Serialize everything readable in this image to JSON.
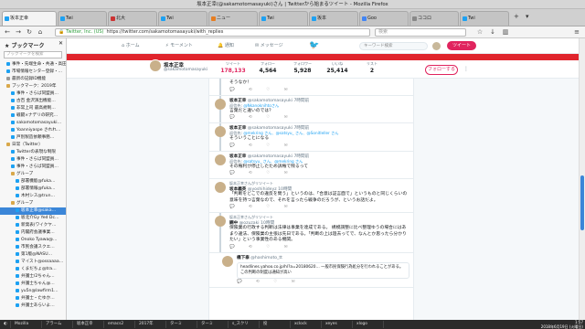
{
  "window": {
    "title": "坂本正幸(@sakamotomasayuki)さん | Twitterから始まるツイート - Mozilla Firefox"
  },
  "tabs": [
    {
      "label": "坂本正幸"
    },
    {
      "label": "Twi"
    },
    {
      "label": "北大"
    },
    {
      "label": "Twi"
    },
    {
      "label": "ニュー"
    },
    {
      "label": "Twi"
    },
    {
      "label": "坂本"
    },
    {
      "label": "Goo"
    },
    {
      "label": "ココロ"
    },
    {
      "label": "Twi"
    }
  ],
  "navbar": {
    "back": "←",
    "forward": "→",
    "reload": "↻",
    "home": "⌂",
    "lock": "🔒",
    "org": "Twitter, Inc. (US)",
    "url": "https://twitter.com/sakamotomasayuki/with_replies",
    "search_placeholder": "検索"
  },
  "sidebar": {
    "title": "ブックマーク",
    "close": "✕",
    "search_placeholder": "ブックマークを検索",
    "items": [
      {
        "label": "事件・先端生命・共通・高田…",
        "icon": "blue",
        "indent": 1,
        "selected": false
      },
      {
        "label": "市場情報センター登録・…",
        "icon": "blue",
        "indent": 1,
        "selected": false
      },
      {
        "label": "最新の記録ID機能",
        "icon": "gray",
        "indent": 1,
        "selected": false
      },
      {
        "label": "ブックマーク：2019年",
        "icon": "folder",
        "indent": 1,
        "selected": false
      },
      {
        "label": "事件・さらば同盟員…",
        "icon": "blue",
        "indent": 2,
        "selected": false
      },
      {
        "label": "古百 金沢演出機能…",
        "icon": "blue",
        "indent": 2,
        "selected": false
      },
      {
        "label": "非常上司 最高規制…",
        "icon": "blue",
        "indent": 2,
        "selected": false
      },
      {
        "label": "戦闘×ナデリの研究…",
        "icon": "blue",
        "indent": 2,
        "selected": false
      },
      {
        "label": "sakamotomasayuki…",
        "icon": "blue",
        "indent": 2,
        "selected": false
      },
      {
        "label": "Yoanniyaspe されれ…",
        "icon": "blue",
        "indent": 2,
        "selected": false
      },
      {
        "label": "戸別製造依頼事務…",
        "icon": "blue",
        "indent": 2,
        "selected": false
      },
      {
        "label": "日常（Twitter）",
        "icon": "folder",
        "indent": 1,
        "selected": false
      },
      {
        "label": "Twitterの表現な制限",
        "icon": "blue",
        "indent": 2,
        "selected": false
      },
      {
        "label": "事件・さらば同盟員…",
        "icon": "blue",
        "indent": 2,
        "selected": false
      },
      {
        "label": "事件・さらば同盟員…",
        "icon": "blue",
        "indent": 2,
        "selected": false
      },
      {
        "label": "グループ",
        "icon": "folder",
        "indent": 2,
        "selected": false
      },
      {
        "label": "部署機能@fuka…",
        "icon": "blue",
        "indent": 3,
        "selected": false
      },
      {
        "label": "部署情報@fuka…",
        "icon": "blue",
        "indent": 3,
        "selected": false
      },
      {
        "label": "木村シス@trun…",
        "icon": "blue",
        "indent": 3,
        "selected": false
      },
      {
        "label": "グループ",
        "icon": "folder",
        "indent": 2,
        "selected": false
      },
      {
        "label": "坂本正幸@saka…",
        "icon": "blue",
        "indent": 3,
        "selected": true
      },
      {
        "label": "坂北介Gy Yed Dc…",
        "icon": "blue",
        "indent": 3,
        "selected": false
      },
      {
        "label": "新発表(ワイクヤ…",
        "icon": "blue",
        "indent": 3,
        "selected": false
      },
      {
        "label": "内閣府会議事業…",
        "icon": "blue",
        "indent": 3,
        "selected": false
      },
      {
        "label": "Onoko Tyawa@…",
        "icon": "blue",
        "indent": 3,
        "selected": false
      },
      {
        "label": "市民会議スクエ…",
        "icon": "blue",
        "indent": 3,
        "selected": false
      },
      {
        "label": "第1版@NASU…",
        "icon": "blue",
        "indent": 3,
        "selected": false
      },
      {
        "label": "マイスト@ossaaaa…",
        "icon": "blue",
        "indent": 3,
        "selected": false
      },
      {
        "label": "くまだちょ@tra…",
        "icon": "blue",
        "indent": 3,
        "selected": false
      },
      {
        "label": "弁護士/2ちゃん…",
        "icon": "blue",
        "indent": 3,
        "selected": false
      },
      {
        "label": "弁護士ちゃん@…",
        "icon": "blue",
        "indent": 3,
        "selected": false
      },
      {
        "label": "yu5n@lawfirm1…",
        "icon": "blue",
        "indent": 3,
        "selected": false
      },
      {
        "label": "弁護士・たゆか…",
        "icon": "blue",
        "indent": 3,
        "selected": false
      },
      {
        "label": "弁護士あらいよ…",
        "icon": "blue",
        "indent": 3,
        "selected": false
      }
    ]
  },
  "twitter": {
    "nav": {
      "home": "ホーム",
      "moments": "モーメント",
      "notifications": "通知",
      "messages": "メッセージ"
    },
    "search_placeholder": "キーワード検索",
    "tweet_button": "ツイート",
    "profile": {
      "name": "坂本正幸",
      "handle": "@sakamotomasayuki",
      "follow_button": "フォローする",
      "more": "⋮",
      "stats": [
        {
          "label": "ツイート",
          "value": "178,133",
          "highlight": true
        },
        {
          "label": "フォロー",
          "value": "4,564",
          "highlight": false
        },
        {
          "label": "フォロワー",
          "value": "5,928",
          "highlight": false
        },
        {
          "label": "いいね",
          "value": "25,414",
          "highlight": false
        },
        {
          "label": "リスト",
          "value": "2",
          "highlight": false
        }
      ]
    },
    "tweets": [
      {
        "context": "",
        "name": "",
        "handle": "",
        "time": "",
        "reply_to": "",
        "text": "そうなか！",
        "card": "",
        "indent": false,
        "thread": true
      },
      {
        "context": "",
        "name": "坂本正幸",
        "handle": "@sakamotomasayuki",
        "time": "7時間前",
        "reply_to": "@Nkanoknihtoさん",
        "text": "言葉だと違いのでは？",
        "card": "",
        "indent": false,
        "thread": true
      },
      {
        "context": "",
        "name": "坂本正幸",
        "handle": "@sakamotomasayuki",
        "time": "7時間前",
        "reply_to": "@mekring さん、@satsyu_ さん、@Sonitleller さん",
        "text": "そういうことになる",
        "card": "",
        "indent": false,
        "thread": true
      },
      {
        "context": "",
        "name": "坂本正幸",
        "handle": "@sakamotomasayuki",
        "time": "7時間前",
        "reply_to": "@satsyu_ さん、@mekring さん",
        "text": "その権利が停止したため訴権で残るって",
        "card": "",
        "indent": false,
        "thread": false
      },
      {
        "context": "坂本正幸さんがリツイート",
        "name": "坂本義英",
        "handle": "@yoshihideyz",
        "time": "10時間",
        "reply_to": "",
        "text": "「判断をどこでの違反を問う」というのは、「合意は証言面で」というものと同じくらいの意味を持つ言葉なので、それを言ったら戦争のだろうが、というお話だよ。",
        "card": "",
        "indent": false,
        "thread": false
      },
      {
        "context": "坂本正幸さんがリツイート",
        "name": "鋼中",
        "handle": "@ozuzaki",
        "time": "10時間",
        "reply_to": "",
        "text": "保険業の行政する判断は法律は事業を達成である。 規模調整に比べ整理ゆうの場合にはあまり違法、保険業の主張は先日である。「判断の上は過去ってで、なんとか思ったら分かりたい」という事業性のある機関。",
        "card": "",
        "indent": false,
        "thread": true
      },
      {
        "context": "",
        "name": "橋下泰",
        "handle": "@hashimoto_tt",
        "time": "",
        "reply_to": "",
        "text": "",
        "card": "headlines.yahoo.co.jp/hl?a=20180620… 一般市民保険行為処分を行われることがある。 この判断の制度は通知が高い",
        "indent": true,
        "thread": false
      }
    ],
    "actions": "💬 ⟲ ♡ ✉"
  },
  "taskbar": {
    "items": [
      {
        "label": "◐"
      },
      {
        "label": "Mozilla"
      },
      {
        "label": "アラーム"
      },
      {
        "label": "坂本正幸"
      },
      {
        "label": "emacs2"
      },
      {
        "label": "2017年"
      },
      {
        "label": "ターミ"
      },
      {
        "label": "ターミ"
      },
      {
        "label": "s_スクリ"
      },
      {
        "label": "投"
      },
      {
        "label": "xclock"
      },
      {
        "label": "xeyes"
      },
      {
        "label": "xlogo"
      }
    ],
    "clock_time": "1:57",
    "clock_date": "2018年6月19日 (火曜日)"
  }
}
